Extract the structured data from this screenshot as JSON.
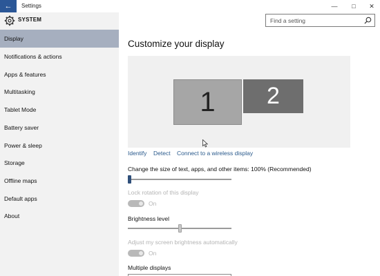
{
  "window": {
    "title": "Settings",
    "back_glyph": "←",
    "min_glyph": "—",
    "max_glyph": "□",
    "close_glyph": "✕"
  },
  "search": {
    "placeholder": "Find a setting"
  },
  "sidebar": {
    "header": "SYSTEM",
    "items": [
      {
        "label": "Display",
        "selected": true
      },
      {
        "label": "Notifications & actions"
      },
      {
        "label": "Apps & features"
      },
      {
        "label": "Multitasking"
      },
      {
        "label": "Tablet Mode"
      },
      {
        "label": "Battery saver"
      },
      {
        "label": "Power & sleep"
      },
      {
        "label": "Storage"
      },
      {
        "label": "Offline maps"
      },
      {
        "label": "Default apps"
      },
      {
        "label": "About"
      }
    ]
  },
  "main": {
    "title": "Customize your display",
    "monitors": [
      {
        "number": "1"
      },
      {
        "number": "2"
      }
    ],
    "links": {
      "identify": "Identify",
      "detect": "Detect",
      "wireless": "Connect to a wireless display"
    },
    "scale": {
      "label": "Change the size of text, apps, and other items: 100% (Recommended)",
      "value_fraction": 0.0
    },
    "lock_rotation": {
      "label": "Lock rotation of this display",
      "state": "On",
      "disabled": true
    },
    "brightness": {
      "label": "Brightness level",
      "value_fraction": 0.5
    },
    "auto_brightness": {
      "label": "Adjust my screen brightness automatically",
      "state": "On",
      "disabled": true
    },
    "multiple_displays": {
      "label": "Multiple displays"
    }
  },
  "colors": {
    "accent": "#2b5797",
    "selected_nav": "#a6afbf",
    "link": "#2a5a8c"
  }
}
